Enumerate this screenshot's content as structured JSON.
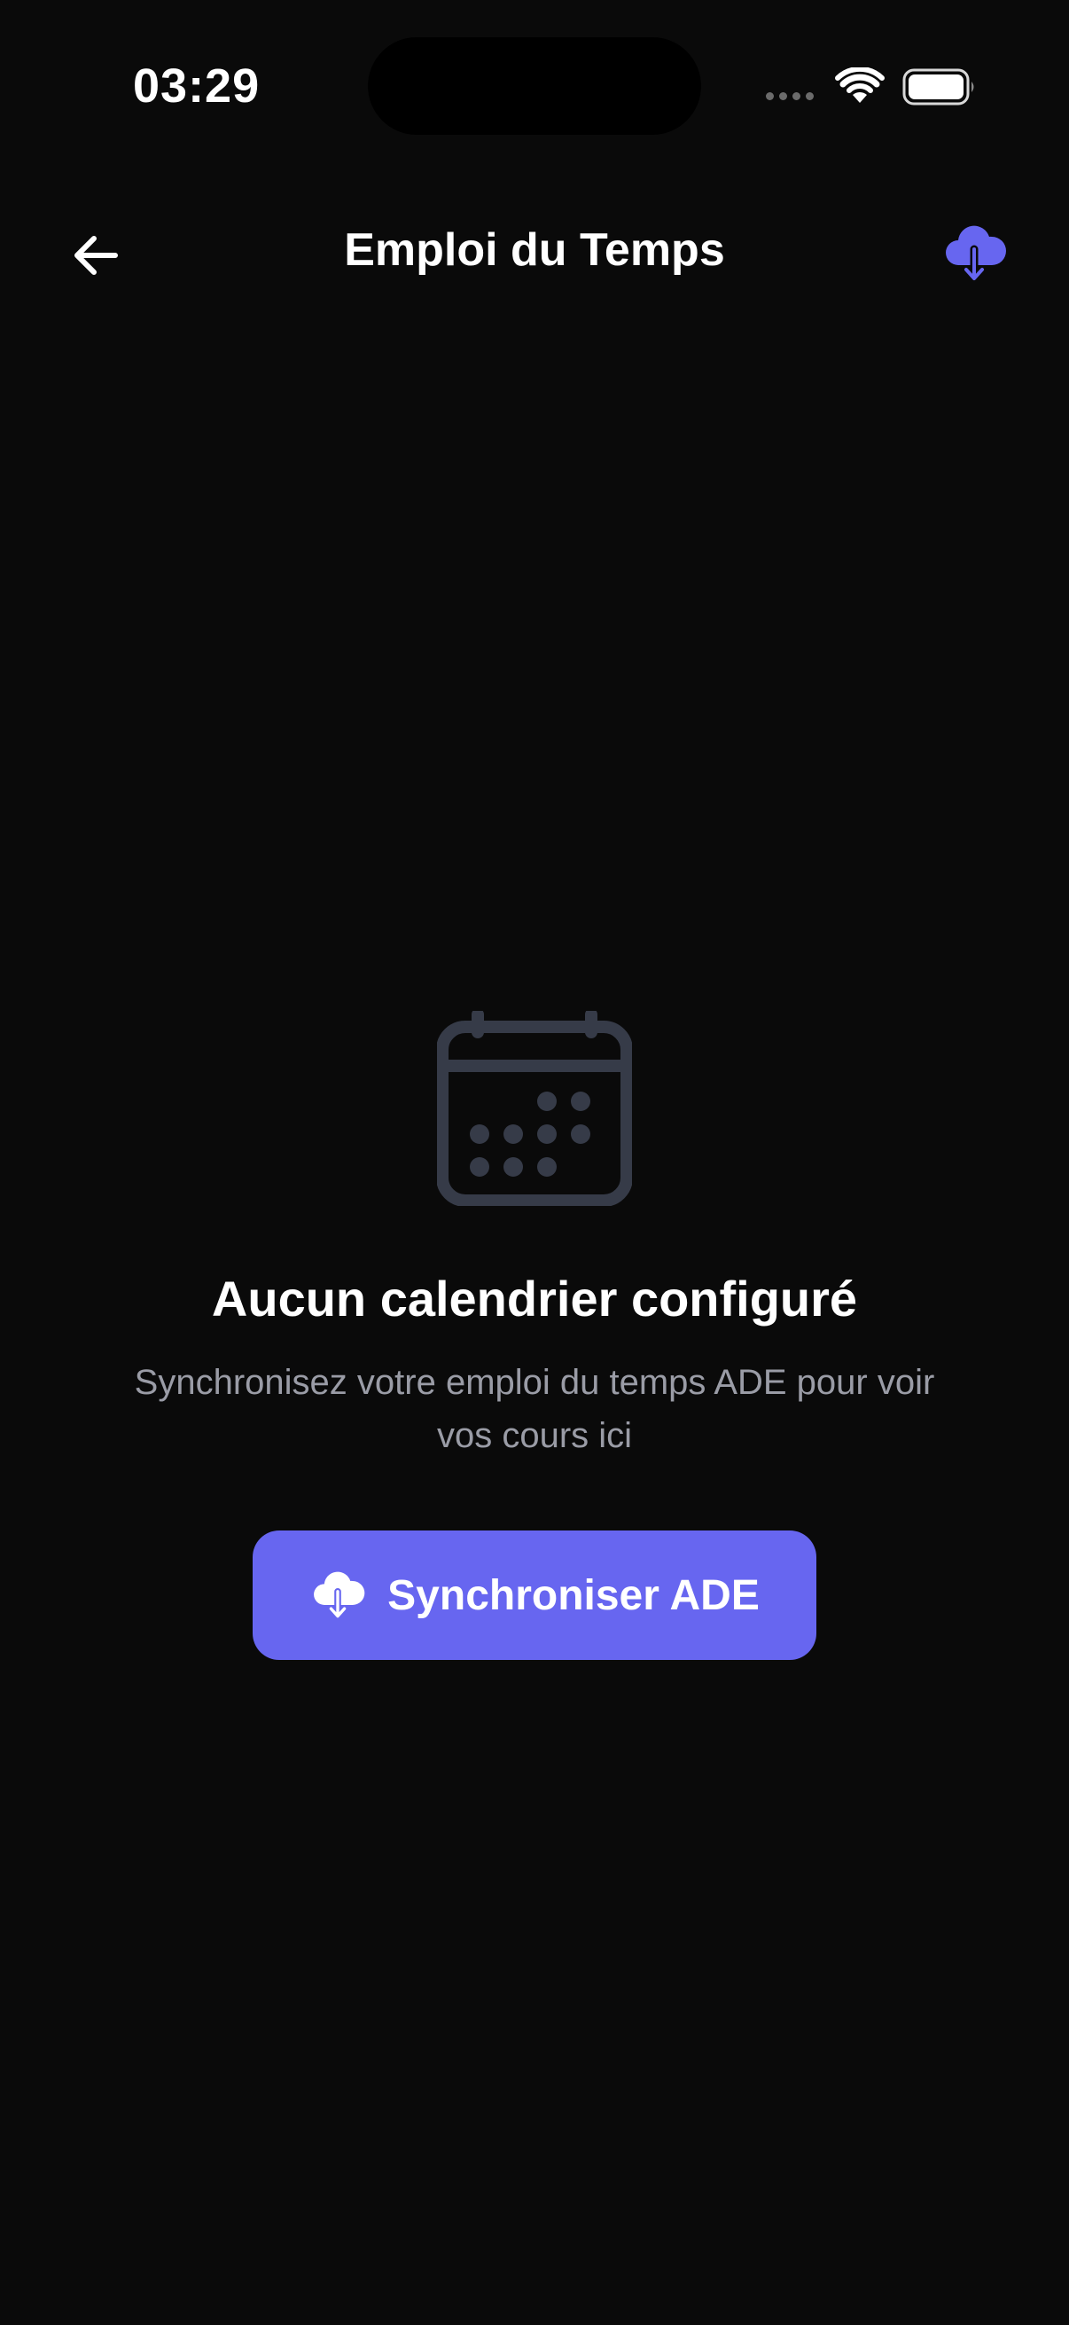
{
  "status_bar": {
    "time": "03:29"
  },
  "header": {
    "title": "Emploi du Temps",
    "back_icon": "arrow-left-icon",
    "action_icon": "cloud-download-icon"
  },
  "empty_state": {
    "icon": "calendar-icon",
    "title": "Aucun calendrier configuré",
    "subtitle": "Synchronisez votre emploi du temps ADE pour voir vos cours ici",
    "button_label": "Synchroniser ADE",
    "button_icon": "cloud-download-icon"
  },
  "colors": {
    "background": "#0a0a0a",
    "accent": "#6766f0",
    "muted_text": "#9a9ca6",
    "icon_muted": "#363b48"
  }
}
